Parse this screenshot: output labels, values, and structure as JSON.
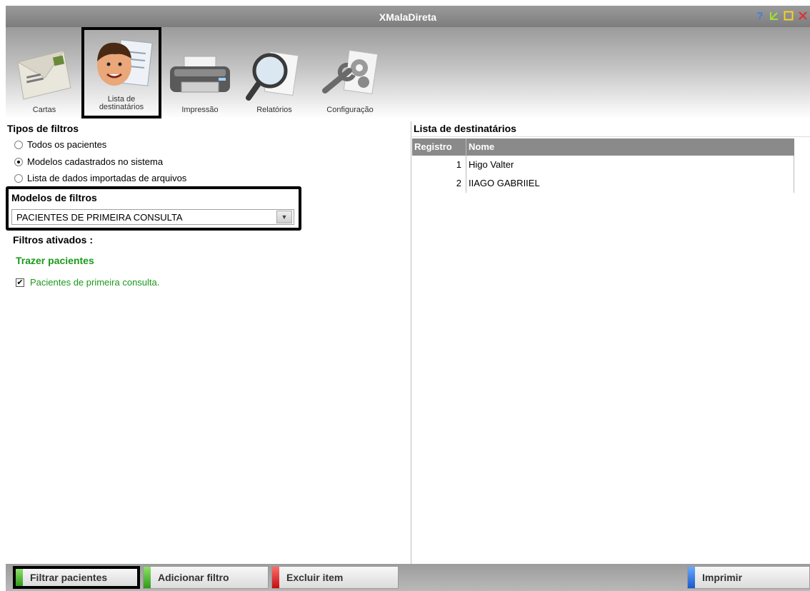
{
  "window": {
    "title": "XMalaDireta",
    "help_glyph": "?",
    "restore_glyph": "↙",
    "maximize_glyph": "□",
    "close_glyph": "X"
  },
  "toolbar": {
    "items": [
      {
        "label": "Cartas"
      },
      {
        "label_line1": "Lista de",
        "label_line2": "destinatários"
      },
      {
        "label": "Impressão"
      },
      {
        "label": "Relatórios"
      },
      {
        "label": "Configuração"
      }
    ]
  },
  "filters": {
    "types_title": "Tipos de filtros",
    "options": [
      {
        "label": "Todos os pacientes",
        "selected": false
      },
      {
        "label": "Modelos cadastrados no sistema",
        "selected": true
      },
      {
        "label": "Lista de dados importadas de arquivos",
        "selected": false
      }
    ],
    "models_title": "Modelos de filtros",
    "selected_model": "PACIENTES DE PRIMEIRA CONSULTA",
    "active_title": "Filtros ativados :",
    "group_label": "Trazer pacientes",
    "active_item": "Pacientes de primeira consulta.",
    "active_item_checked": true
  },
  "recipients": {
    "title": "Lista de destinatários",
    "columns": [
      "Registro",
      "Nome"
    ],
    "rows": [
      {
        "registro": "1",
        "nome": "Higo Valter"
      },
      {
        "registro": "2",
        "nome": "IIAGO GABRIIEL"
      }
    ]
  },
  "bottom": {
    "filter_button": "Filtrar pacientes",
    "add_button": "Adicionar filtro",
    "delete_button": "Excluir item",
    "print_button": "Imprimir"
  },
  "colors": {
    "green_accent": "#1a9a1a",
    "red_accent": "#d42020",
    "blue_accent": "#2a6fd6",
    "titlebar": "#8a8a8a"
  }
}
